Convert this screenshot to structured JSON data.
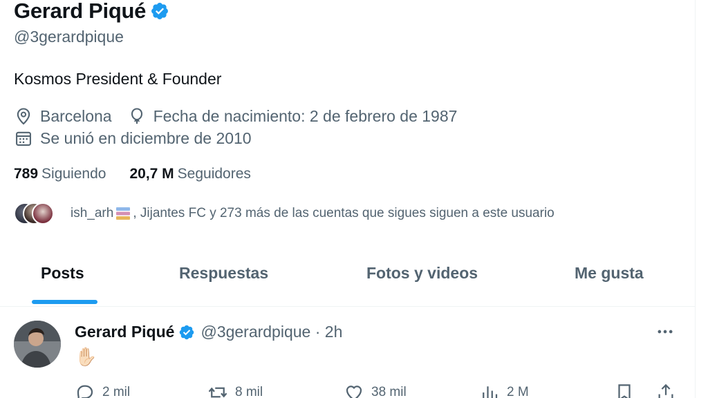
{
  "profile": {
    "name": "Gerard Piqué",
    "handle": "@3gerardpique",
    "bio": "Kosmos President & Founder",
    "location": "Barcelona",
    "birthdate": "Fecha de nacimiento: 2 de febrero de 1987",
    "joined": "Se unió en diciembre de 2010",
    "following_count": "789",
    "following_label": "Siguiendo",
    "followers_count": "20,7 M",
    "followers_label": "Seguidores",
    "known_followers_prefix": "ish_arh",
    "known_followers_suffix": ", Jijantes FC y 273 más de las cuentas que sigues siguen a este usuario"
  },
  "tabs": [
    {
      "label": "Posts",
      "active": true
    },
    {
      "label": "Respuestas",
      "active": false
    },
    {
      "label": "Fotos y videos",
      "active": false
    },
    {
      "label": "Me gusta",
      "active": false
    }
  ],
  "tweet": {
    "name": "Gerard Piqué",
    "handle_time": "@3gerardpique · 2h",
    "body": "✋🏻",
    "replies": "2 mil",
    "retweets": "8 mil",
    "likes": "38 mil",
    "views": "2 M"
  },
  "colors": {
    "accent": "#1d9bf0",
    "text": "#0f1419",
    "muted": "#536471",
    "border": "#eff3f4"
  },
  "icons": [
    "verified-badge-icon",
    "location-pin-icon",
    "balloon-icon",
    "calendar-icon",
    "books-emoji-icon",
    "more-icon",
    "reply-icon",
    "retweet-icon",
    "like-icon",
    "views-icon",
    "bookmark-icon",
    "share-icon"
  ]
}
